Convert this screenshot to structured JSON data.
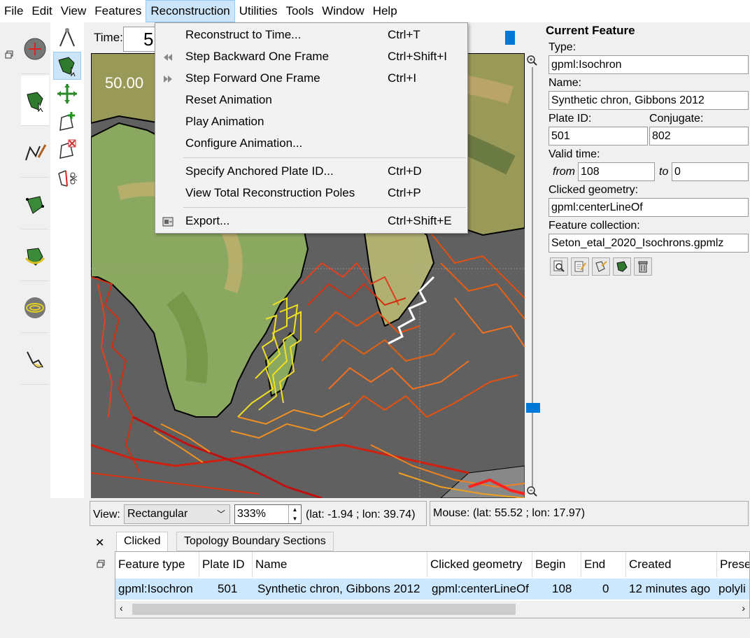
{
  "menubar": {
    "items": [
      "File",
      "Edit",
      "View",
      "Features",
      "Reconstruction",
      "Utilities",
      "Tools",
      "Window",
      "Help"
    ],
    "active_index": 4
  },
  "reconstruction_menu": {
    "items": [
      {
        "label": "Reconstruct to Time...",
        "shortcut": "Ctrl+T",
        "icon": ""
      },
      {
        "label": "Step Backward One Frame",
        "shortcut": "Ctrl+Shift+I",
        "icon": "step-backward-icon"
      },
      {
        "label": "Step Forward One Frame",
        "shortcut": "Ctrl+I",
        "icon": "step-forward-icon"
      },
      {
        "label": "Reset Animation",
        "shortcut": "",
        "icon": ""
      },
      {
        "label": "Play Animation",
        "shortcut": "",
        "icon": ""
      },
      {
        "label": "Configure Animation...",
        "shortcut": "",
        "icon": ""
      },
      {
        "label": "Specify Anchored Plate ID...",
        "shortcut": "Ctrl+D",
        "icon": ""
      },
      {
        "label": "View Total Reconstruction Poles",
        "shortcut": "Ctrl+P",
        "icon": ""
      },
      {
        "label": "Export...",
        "shortcut": "Ctrl+Shift+E",
        "icon": "export-icon"
      }
    ]
  },
  "timebar": {
    "label": "Time:",
    "value": "5"
  },
  "globe": {
    "time_overlay": "50.00"
  },
  "viewbar": {
    "view_label": "View:",
    "projection": "Rectangular",
    "zoom": "333%",
    "camera_coords": "(lat: -1.94 ; lon: 39.74)",
    "mouse_coords": "Mouse: (lat: 55.52 ; lon: 17.97)"
  },
  "bottom_panel": {
    "tabs": [
      "Clicked",
      "Topology Boundary Sections"
    ],
    "columns": [
      "Feature type",
      "Plate ID",
      "Name",
      "Clicked geometry",
      "Begin",
      "End",
      "Created",
      "Prese"
    ],
    "row": {
      "feature_type": "gpml:Isochron",
      "plate_id": "501",
      "name": "Synthetic chron, Gibbons 2012",
      "clicked_geometry": "gpml:centerLineOf",
      "begin": "108",
      "end": "0",
      "created": "12 minutes ago",
      "present": "polyli"
    }
  },
  "current_feature": {
    "title": "Current Feature",
    "type_label": "Type:",
    "type_value": "gpml:Isochron",
    "name_label": "Name:",
    "name_value": "Synthetic chron, Gibbons 2012",
    "plate_id_label": "Plate ID:",
    "plate_id_value": "501",
    "conjugate_label": "Conjugate:",
    "conjugate_value": "802",
    "valid_time_label": "Valid time:",
    "from_label": "from",
    "from_value": "108",
    "to_label": "to",
    "to_value": "0",
    "clicked_geometry_label": "Clicked geometry:",
    "clicked_geometry_value": "gpml:centerLineOf",
    "feature_collection_label": "Feature collection:",
    "feature_collection_value": "Seton_etal_2020_Isochrons.gpmlz"
  },
  "colors": {
    "accent": "#0078d7",
    "menu_highlight": "#cce4f7",
    "selected_row": "#cce8ff",
    "ocean": "#606060"
  }
}
